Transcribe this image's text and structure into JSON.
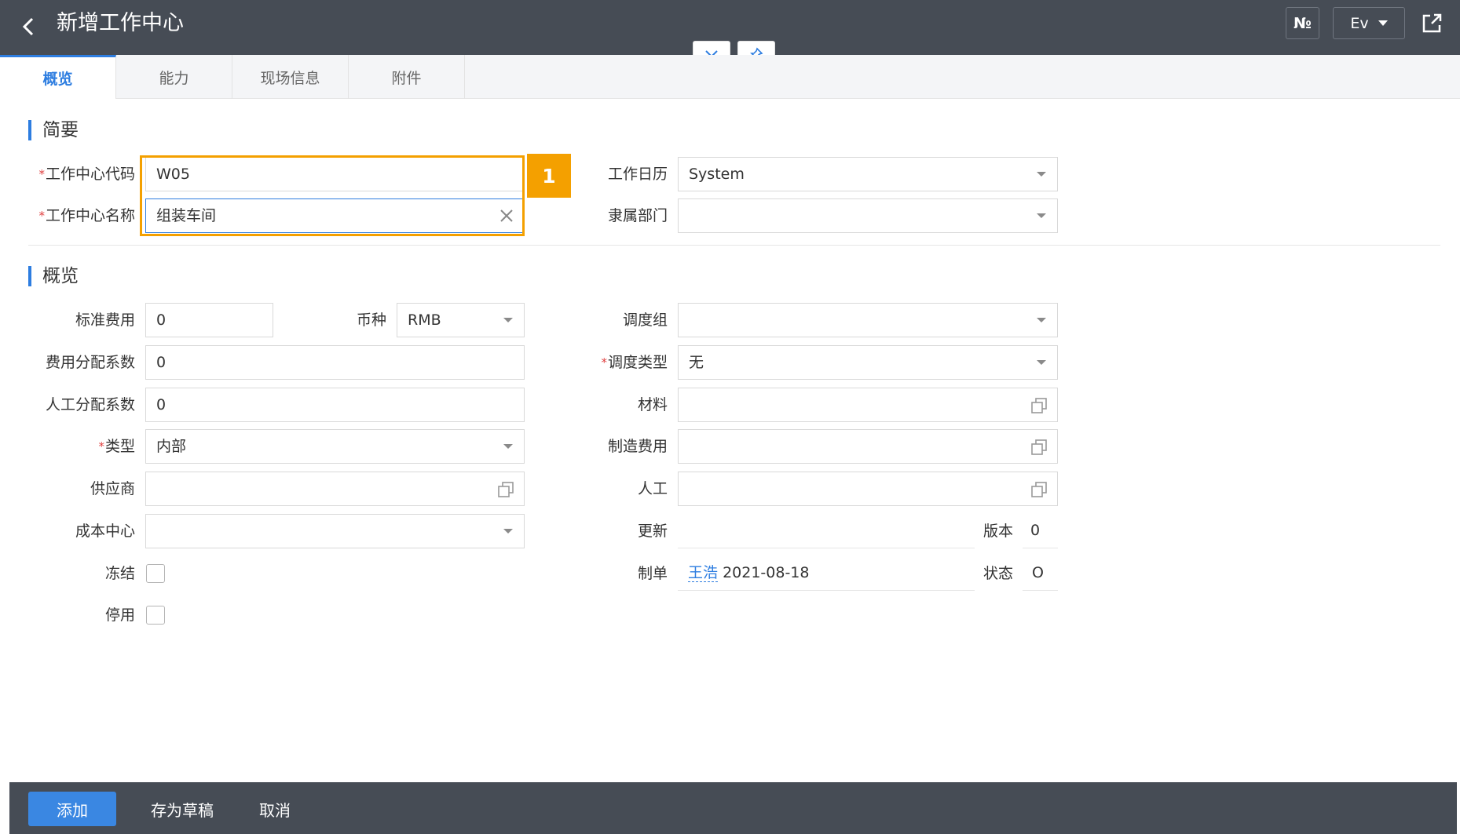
{
  "header": {
    "title": "新增工作中心",
    "no_label": "№",
    "lang_label": "Ev"
  },
  "tabs": [
    {
      "label": "概览",
      "active": true
    },
    {
      "label": "能力",
      "active": false
    },
    {
      "label": "现场信息",
      "active": false
    },
    {
      "label": "附件",
      "active": false
    }
  ],
  "summary": {
    "title": "简要",
    "code_label": "工作中心代码",
    "code_value": "W05",
    "name_label": "工作中心名称",
    "name_value": "组装车间",
    "calendar_label": "工作日历",
    "calendar_value": "System",
    "dept_label": "隶属部门",
    "dept_value": "",
    "badge": "1"
  },
  "overview": {
    "title": "概览",
    "std_cost_label": "标准费用",
    "std_cost_value": "0",
    "currency_label": "币种",
    "currency_value": "RMB",
    "cost_factor_label": "费用分配系数",
    "cost_factor_value": "0",
    "labor_factor_label": "人工分配系数",
    "labor_factor_value": "0",
    "type_label": "类型",
    "type_value": "内部",
    "supplier_label": "供应商",
    "supplier_value": "",
    "cost_center_label": "成本中心",
    "cost_center_value": "",
    "freeze_label": "冻结",
    "disable_label": "停用",
    "dispatch_group_label": "调度组",
    "dispatch_group_value": "",
    "dispatch_type_label": "调度类型",
    "dispatch_type_value": "无",
    "material_label": "材料",
    "mfg_cost_label": "制造费用",
    "labor_label": "人工",
    "update_label": "更新",
    "update_value": "",
    "version_label": "版本",
    "version_value": "0",
    "creator_label": "制单",
    "creator_name": "王浩",
    "creator_date": "2021-08-18",
    "status_label": "状态",
    "status_value": "O"
  },
  "footer": {
    "add_label": "添加",
    "draft_label": "存为草稿",
    "cancel_label": "取消"
  },
  "colors": {
    "header_bg": "#464c55",
    "accent": "#2d7de0",
    "highlight": "#f4a000",
    "required": "#e04040"
  }
}
